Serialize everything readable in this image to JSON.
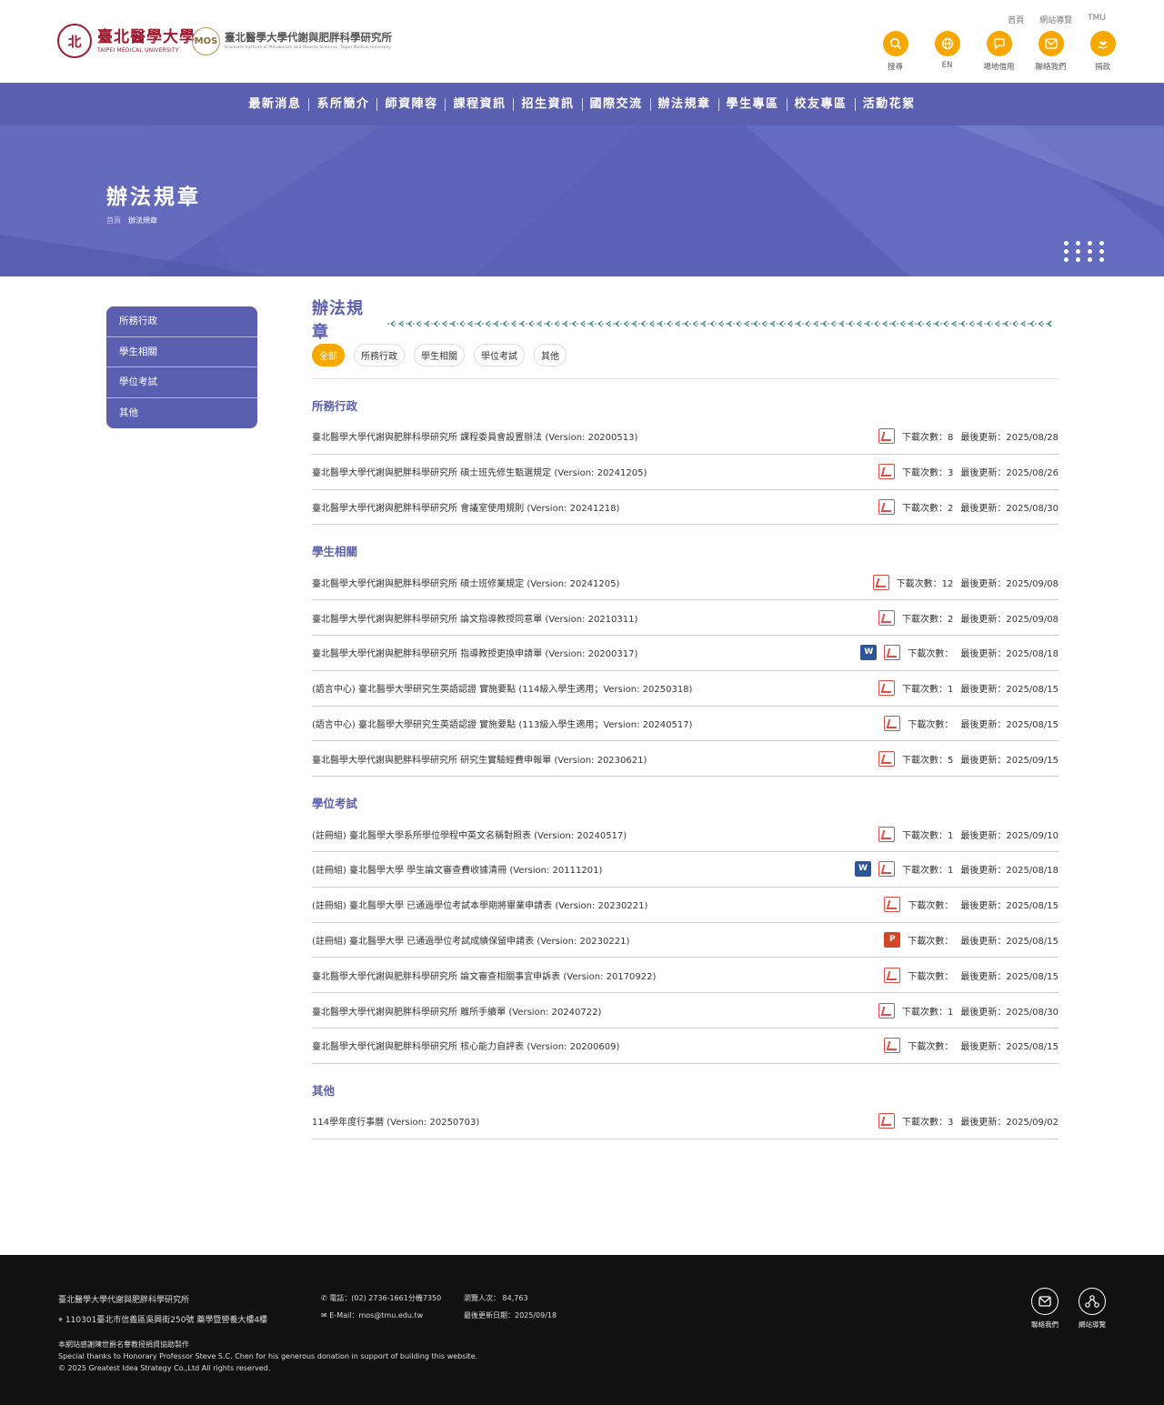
{
  "header": {
    "tmu_logo": {
      "seal": "北",
      "zh": "臺北醫學大學",
      "en": "TAIPEI MEDICAL UNIVERSITY"
    },
    "mos_logo": {
      "seal": "MOS",
      "zh": "臺北醫學大學代謝與肥胖科學研究所",
      "en": "Graduate Institute of Metabolism and Obesity Sciences, Taipei Medical University"
    },
    "top_links": [
      "首頁",
      "網站導覽",
      "TMU"
    ],
    "icon_buttons": [
      {
        "label": "搜尋",
        "icon": "search-icon"
      },
      {
        "label": "EN",
        "icon": "globe-icon"
      },
      {
        "label": "場地借用",
        "icon": "chat-icon"
      },
      {
        "label": "聯絡我們",
        "icon": "mail-icon"
      },
      {
        "label": "捐款",
        "icon": "donate-icon"
      }
    ]
  },
  "nav": [
    "最新消息",
    "系所簡介",
    "師資陣容",
    "課程資訊",
    "招生資訊",
    "國際交流",
    "辦法規章",
    "學生專區",
    "校友專區",
    "活動花絮"
  ],
  "banner": {
    "title": "辦法規章",
    "crumb_home": "首頁",
    "crumb_current": "辦法規章"
  },
  "sidebar": [
    "所務行政",
    "學生相關",
    "學位考試",
    "其他"
  ],
  "main": {
    "title": "辦法規章",
    "tabs": [
      "全部",
      "所務行政",
      "學生相關",
      "學位考試",
      "其他"
    ],
    "active_tab": "全部",
    "groups": [
      {
        "title": "所務行政",
        "rows": [
          {
            "name": "臺北醫學大學代謝與肥胖科學研究所 課程委員會設置辦法 (Version: 20200513)",
            "files": [
              "pdf"
            ],
            "count": "下載次數：8",
            "updated": "最後更新：2025/08/28"
          },
          {
            "name": "臺北醫學大學代謝與肥胖科學研究所 碩士班先修生甄選規定 (Version: 20241205)",
            "files": [
              "pdf"
            ],
            "count": "下載次數：3",
            "updated": "最後更新：2025/08/26"
          },
          {
            "name": "臺北醫學大學代謝與肥胖科學研究所 會議室使用規則 (Version: 20241218)",
            "files": [
              "pdf"
            ],
            "count": "下載次數：2",
            "updated": "最後更新：2025/08/30"
          }
        ]
      },
      {
        "title": "學生相關",
        "rows": [
          {
            "name": "臺北醫學大學代謝與肥胖科學研究所 碩士班修業規定 (Version: 20241205)",
            "files": [
              "pdf"
            ],
            "count": "下載次數：12",
            "updated": "最後更新：2025/09/08"
          },
          {
            "name": "臺北醫學大學代謝與肥胖科學研究所 論文指導教授同意單 (Version: 20210311)",
            "files": [
              "pdf"
            ],
            "count": "下載次數：2",
            "updated": "最後更新：2025/09/08"
          },
          {
            "name": "臺北醫學大學代謝與肥胖科學研究所 指導教授更換申請單 (Version: 20200317)",
            "files": [
              "word",
              "pdf"
            ],
            "count": "下載次數：",
            "updated": "最後更新：2025/08/18"
          },
          {
            "name": "(語言中心) 臺北醫學大學研究生英語認證 實施要點 (114級入學生適用；Version: 20250318)",
            "files": [
              "pdf"
            ],
            "count": "下載次數：1",
            "updated": "最後更新：2025/08/15"
          },
          {
            "name": "(語言中心) 臺北醫學大學研究生英語認證 實施要點 (113級入學生適用；Version: 20240517)",
            "files": [
              "pdf"
            ],
            "count": "下載次數：",
            "updated": "最後更新：2025/08/15"
          },
          {
            "name": "臺北醫學大學代謝與肥胖科學研究所 研究生實驗經費申報單 (Version: 20230621)",
            "files": [
              "pdf"
            ],
            "count": "下載次數：5",
            "updated": "最後更新：2025/09/15"
          }
        ]
      },
      {
        "title": "學位考試",
        "rows": [
          {
            "name": "(註冊組) 臺北醫學大學系所學位學程中英文名稱對照表 (Version: 20240517)",
            "files": [
              "pdf"
            ],
            "count": "下載次數：1",
            "updated": "最後更新：2025/09/10"
          },
          {
            "name": "(註冊組) 臺北醫學大學 學生論文審查費收據清冊 (Version: 20111201)",
            "files": [
              "word",
              "pdf"
            ],
            "count": "下載次數：1",
            "updated": "最後更新：2025/08/18"
          },
          {
            "name": "(註冊組) 臺北醫學大學 已通過學位考試本學期將畢業申請表 (Version: 20230221)",
            "files": [
              "pdf"
            ],
            "count": "下載次數：",
            "updated": "最後更新：2025/08/15"
          },
          {
            "name": "(註冊組) 臺北醫學大學 已通過學位考試成績保留申請表 (Version: 20230221)",
            "files": [
              "ppt"
            ],
            "count": "下載次數：",
            "updated": "最後更新：2025/08/15"
          },
          {
            "name": "臺北醫學大學代謝與肥胖科學研究所 論文審查相關事宜申訴表 (Version: 20170922)",
            "files": [
              "pdf"
            ],
            "count": "下載次數：",
            "updated": "最後更新：2025/08/15"
          },
          {
            "name": "臺北醫學大學代謝與肥胖科學研究所 離所手續單 (Version: 20240722)",
            "files": [
              "pdf"
            ],
            "count": "下載次數：1",
            "updated": "最後更新：2025/08/30"
          },
          {
            "name": "臺北醫學大學代謝與肥胖科學研究所 核心能力自評表 (Version: 20200609)",
            "files": [
              "pdf"
            ],
            "count": "下載次數：",
            "updated": "最後更新：2025/08/15"
          }
        ]
      },
      {
        "title": "其他",
        "rows": [
          {
            "name": "114學年度行事曆 (Version: 20250703)",
            "files": [
              "pdf"
            ],
            "count": "下載次數：3",
            "updated": "最後更新：2025/09/02"
          }
        ]
      }
    ]
  },
  "footer": {
    "title": "臺北醫學大學代謝與肥胖科學研究所",
    "address": "110301臺北市信義區吳興街250號 藥學暨營養大樓4樓",
    "tel": "電話：(02) 2736-1661分機7350",
    "email": "E-Mail：mos@tmu.edu.tw",
    "visitors": "瀏覽人次： 84,763",
    "last_update": "最後更新日期：2025/09/18",
    "credit_lines": [
      "本網站感謝陳世爵名譽教授捐資協助製作",
      "Special thanks to Honorary Professor Steve S.C. Chen for his generous donation in support of building this website.",
      "© 2025 Greatest Idea Strategy Co.,Ltd All rights reserved."
    ],
    "buttons": [
      {
        "label": "聯絡我們",
        "icon": "mail-icon"
      },
      {
        "label": "網站導覽",
        "icon": "sitemap-icon"
      }
    ]
  },
  "colors": {
    "primary": "#5b5fb0",
    "accent": "#f6a800",
    "pdf": "#e24b3f",
    "word": "#2b579a",
    "ppt": "#d24726",
    "footer": "#111111"
  }
}
